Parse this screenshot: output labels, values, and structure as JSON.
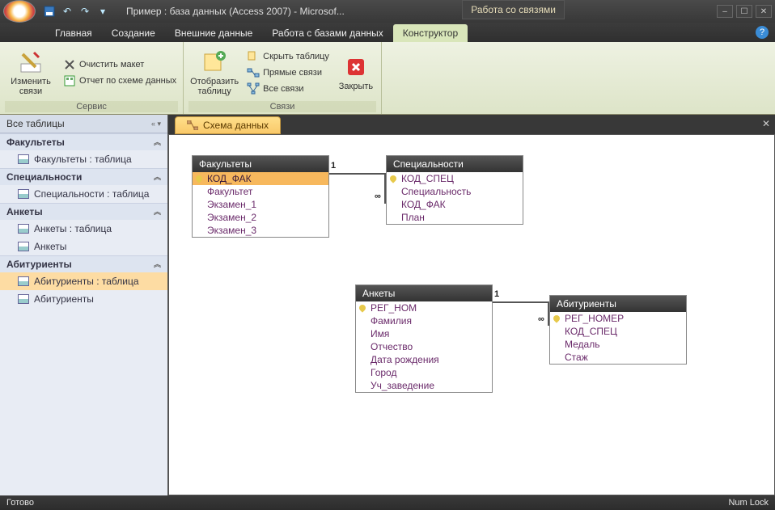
{
  "title": "Пример : база данных (Access 2007) - Microsof...",
  "context_tab": "Работа со связями",
  "tabs": [
    "Главная",
    "Создание",
    "Внешние данные",
    "Работа с базами данных",
    "Конструктор"
  ],
  "active_tab": 4,
  "ribbon": {
    "groups": [
      {
        "label": "Сервис",
        "big": {
          "label": "Изменить связи"
        },
        "items": [
          "Очистить макет",
          "Отчет по схеме данных"
        ]
      },
      {
        "label": "Связи",
        "big": {
          "label": "Отобразить таблицу"
        },
        "items": [
          "Скрыть таблицу",
          "Прямые связи",
          "Все связи"
        ],
        "close": "Закрыть"
      }
    ]
  },
  "nav": {
    "header": "Все таблицы",
    "groups": [
      {
        "title": "Факультеты",
        "items": [
          "Факультеты : таблица"
        ]
      },
      {
        "title": "Специальности",
        "items": [
          "Специальности : таблица"
        ]
      },
      {
        "title": "Анкеты",
        "items": [
          "Анкеты : таблица",
          "Анкеты"
        ]
      },
      {
        "title": "Абитуриенты",
        "items": [
          "Абитуриенты : таблица",
          "Абитуриенты"
        ],
        "selected": 0
      }
    ]
  },
  "doc_tab": "Схема данных",
  "entities": {
    "fakultety": {
      "title": "Факультеты",
      "fields": [
        {
          "name": "КОД_ФАК",
          "key": true,
          "sel": true
        },
        {
          "name": "Факультет"
        },
        {
          "name": "Экзамен_1"
        },
        {
          "name": "Экзамен_2"
        },
        {
          "name": "Экзамен_3"
        }
      ]
    },
    "spec": {
      "title": "Специальности",
      "fields": [
        {
          "name": "КОД_СПЕЦ",
          "key": true
        },
        {
          "name": "Специальность"
        },
        {
          "name": "КОД_ФАК"
        },
        {
          "name": "План"
        }
      ]
    },
    "ankety": {
      "title": "Анкеты",
      "fields": [
        {
          "name": "РЕГ_НОМ",
          "key": true
        },
        {
          "name": "Фамилия"
        },
        {
          "name": "Имя"
        },
        {
          "name": "Отчество"
        },
        {
          "name": "Дата рождения"
        },
        {
          "name": "Город"
        },
        {
          "name": "Уч_заведение"
        }
      ]
    },
    "abitur": {
      "title": "Абитуриенты",
      "fields": [
        {
          "name": "РЕГ_НОМЕР",
          "key": true
        },
        {
          "name": "КОД_СПЕЦ"
        },
        {
          "name": "Медаль"
        },
        {
          "name": "Стаж"
        }
      ]
    }
  },
  "rel_labels": {
    "one": "1",
    "many": "∞"
  },
  "status": {
    "left": "Готово",
    "right": "Num Lock"
  }
}
